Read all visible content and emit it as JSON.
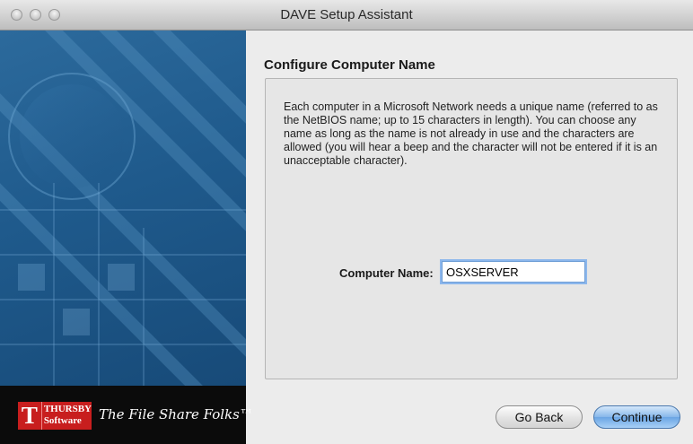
{
  "window": {
    "title": "DAVE Setup Assistant"
  },
  "brand": {
    "logo_letter": "T",
    "logo_line1": "THURSBY",
    "logo_line2": "Software",
    "tagline": "The File Share Folks™"
  },
  "content": {
    "heading": "Configure Computer Name",
    "description": "Each computer in a Microsoft Network needs a unique name (referred to as the NetBIOS name; up to 15 characters in length). You can choose any name as long as the name is not already in use and the characters are allowed (you will hear a beep and the character will not be entered if it is an unacceptable character).",
    "field_label": "Computer Name:",
    "computer_name": "OSXSERVER"
  },
  "buttons": {
    "back": "Go Back",
    "continue": "Continue"
  }
}
